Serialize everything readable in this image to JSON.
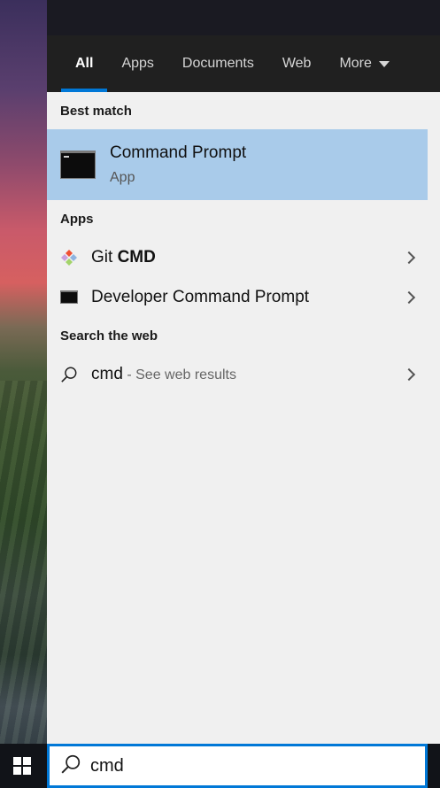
{
  "tabs": [
    {
      "label": "All"
    },
    {
      "label": "Apps"
    },
    {
      "label": "Documents"
    },
    {
      "label": "Web"
    },
    {
      "label": "More"
    }
  ],
  "sections": {
    "best_match": "Best match",
    "apps": "Apps",
    "web": "Search the web"
  },
  "best_match": {
    "title": "Command Prompt",
    "subtitle": "App"
  },
  "apps": [
    {
      "prefix": "Git ",
      "bold": "CMD",
      "icon": "git-icon"
    },
    {
      "label": "Developer Command Prompt",
      "icon": "command-prompt-icon"
    }
  ],
  "web_result": {
    "query": "cmd",
    "suffix": " - See web results"
  },
  "search": {
    "value": "cmd"
  },
  "colors": {
    "accent": "#0078d7",
    "highlight": "#a9cbea",
    "panel": "#f0f0f0",
    "tabbar": "#202020"
  }
}
